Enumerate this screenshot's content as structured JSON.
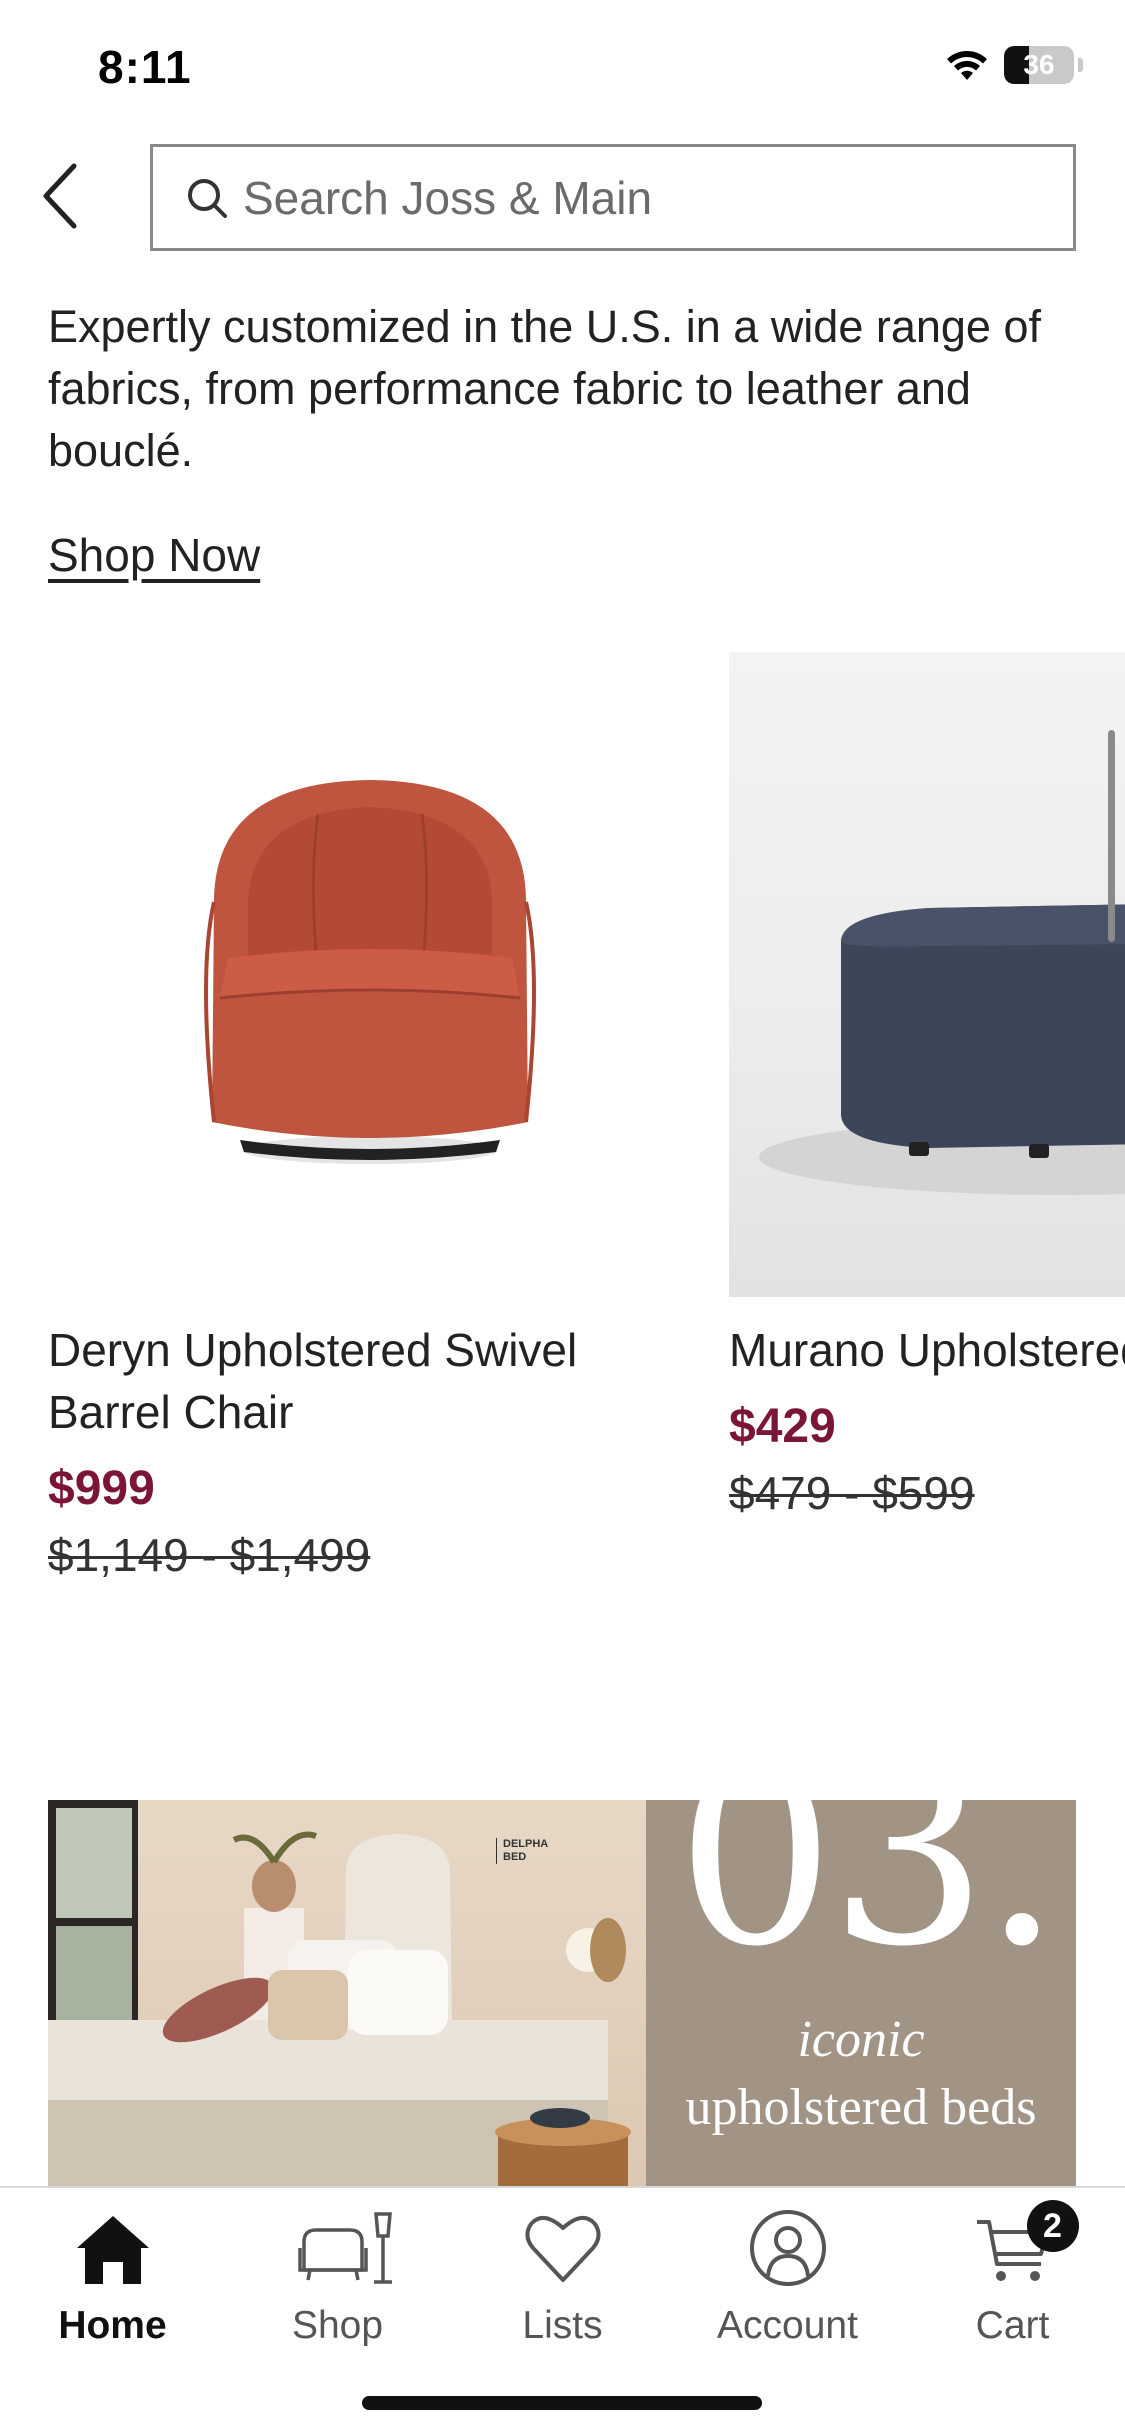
{
  "status_bar": {
    "time": "8:11",
    "battery_level": "36",
    "icons": [
      "wifi-icon",
      "battery-icon"
    ]
  },
  "header": {
    "back_icon": "chevron-left-icon",
    "search_icon": "search-icon",
    "search_placeholder": "Search Joss & Main"
  },
  "promo": {
    "description": "Expertly customized in the U.S. in a wide range of fabrics, from performance fabric to leather and bouclé.",
    "link_label": "Shop Now"
  },
  "products": [
    {
      "name": "Deryn Upholstered Swivel Barrel Chair",
      "price": "$999",
      "original_price": "$1,149 - $1,499",
      "color": "#c0553f"
    },
    {
      "name": "Murano Upholstered",
      "price": "$429",
      "original_price": "$479 - $599",
      "color": "#3c4658"
    }
  ],
  "banner": {
    "number": "03.",
    "subtitle_line1": "iconic",
    "subtitle_line2": "upholstered beds",
    "tag_line1": "DELPHA",
    "tag_line2": "BED"
  },
  "tab_bar": {
    "tabs": [
      {
        "label": "Home",
        "icon": "home-icon",
        "active": true
      },
      {
        "label": "Shop",
        "icon": "furniture-icon",
        "active": false
      },
      {
        "label": "Lists",
        "icon": "heart-icon",
        "active": false
      },
      {
        "label": "Account",
        "icon": "account-icon",
        "active": false
      },
      {
        "label": "Cart",
        "icon": "cart-icon",
        "active": false
      }
    ],
    "cart_count": "2"
  },
  "colors": {
    "sale_price": "#7a1537",
    "text": "#222222",
    "banner_side": "#a19484"
  }
}
